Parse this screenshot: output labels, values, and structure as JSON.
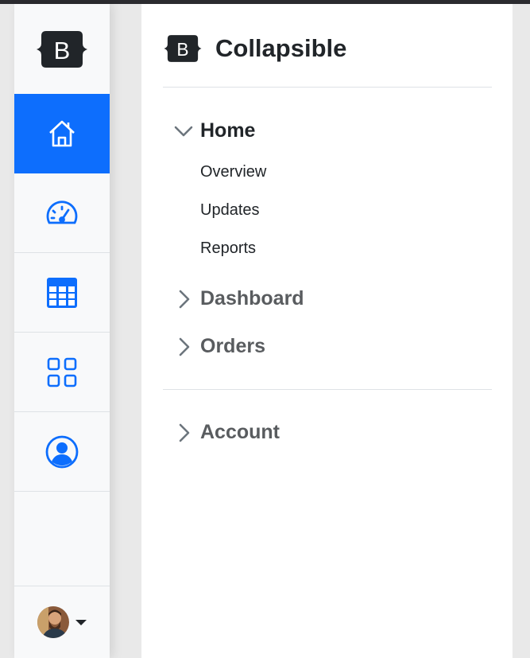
{
  "rail": {
    "brand_letter": "B",
    "items": [
      {
        "icon": "home-icon",
        "active": true
      },
      {
        "icon": "speedometer-icon",
        "active": false
      },
      {
        "icon": "table-icon",
        "active": false
      },
      {
        "icon": "grid-icon",
        "active": false
      },
      {
        "icon": "person-circle-icon",
        "active": false
      }
    ],
    "accent_color": "#0d6efd"
  },
  "panel": {
    "brand_letter": "B",
    "title": "Collapsible",
    "sections": [
      {
        "label": "Home",
        "expanded": true,
        "links": [
          "Overview",
          "Updates",
          "Reports"
        ]
      },
      {
        "label": "Dashboard",
        "expanded": false
      },
      {
        "label": "Orders",
        "expanded": false
      },
      {
        "label": "Account",
        "expanded": false
      }
    ]
  }
}
